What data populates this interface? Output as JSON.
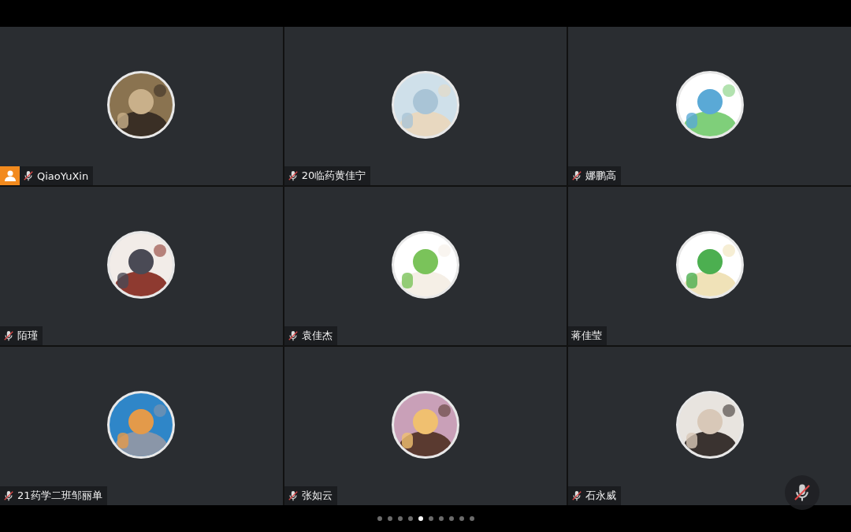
{
  "participants": [
    {
      "name": "QiaoYuXin",
      "muted": true,
      "host": true
    },
    {
      "name": "20临药黄佳宁",
      "muted": true,
      "host": false
    },
    {
      "name": "娜鹏高",
      "muted": true,
      "host": false
    },
    {
      "name": "陌瑾",
      "muted": true,
      "host": false
    },
    {
      "name": "袁佳杰",
      "muted": true,
      "host": false
    },
    {
      "name": "蒋佳莹",
      "muted": false,
      "host": false
    },
    {
      "name": "21药学二班邹丽单",
      "muted": true,
      "host": false
    },
    {
      "name": "张如云",
      "muted": true,
      "host": false
    },
    {
      "name": "石永威",
      "muted": true,
      "host": false
    }
  ],
  "mic_button": {
    "muted": true
  },
  "pages": [
    {
      "selected": false
    },
    {
      "selected": false
    },
    {
      "selected": false
    },
    {
      "selected": false
    },
    {
      "selected": true
    },
    {
      "selected": false
    },
    {
      "selected": false
    },
    {
      "selected": false
    },
    {
      "selected": false
    },
    {
      "selected": false
    }
  ]
}
